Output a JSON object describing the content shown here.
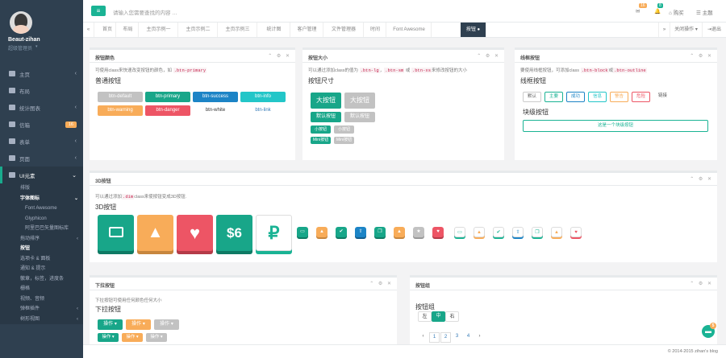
{
  "profile": {
    "name": "Beaut-zihan",
    "role": "超级管理员"
  },
  "sidebar": {
    "items": [
      {
        "label": "主页"
      },
      {
        "label": "布局"
      },
      {
        "label": "统计图表"
      },
      {
        "label": "信箱",
        "badge": "16"
      },
      {
        "label": "表单"
      },
      {
        "label": "页面"
      },
      {
        "label": "UI元素"
      }
    ],
    "sub": [
      "排版",
      "字体图标",
      "Font Awesome",
      "Glyphicon",
      "阿里巴巴矢量图标库",
      "拖动排序",
      "按钮",
      "选项卡 & 面板",
      "通知 & 提示",
      "徽章，标签，进度条",
      "栅格",
      "视频、音频",
      "弹框插件",
      "树形视图"
    ]
  },
  "top": {
    "search": "请输入您需要查找的内容 …",
    "msg_badge": "16",
    "bell_badge": "8",
    "nav1": "购买",
    "nav2": "主题"
  },
  "tabs": {
    "items": [
      "首页",
      "布局",
      "主页示例一",
      "主页示例二",
      "主页示例三",
      "统计图",
      "客户管理",
      "文件管理器",
      "时间",
      "Font Awesome",
      "按钮"
    ],
    "op": "关闭操作",
    "out": "退出"
  },
  "p1": {
    "title": "按钮颜色",
    "desc": "可使用class来快速改变按钮的颜色，如",
    "code": ".btn-primary",
    "h": "普通按钮",
    "btns": [
      "btn-default",
      "btn-primary",
      "btn-success",
      "btn-info",
      "btn-warning",
      "btn-danger",
      "btn-white",
      "btn-link"
    ]
  },
  "p2": {
    "title": "按钮大小",
    "desc1": "可以通过添加class的值为",
    "c1": ".btn-lg",
    ",": "，",
    "c2": ".btn-sm",
    "or": "或",
    "c3": ".btn-xs",
    "desc2": "来修改按钮的大小",
    "h": "按钮尺寸",
    "lg": "大按钮",
    "def": "默认按钮",
    "sm": "小按钮",
    "xs": "Mini按钮"
  },
  "p3": {
    "title": "线框按钮",
    "desc": "要使用线框按钮，可添加class",
    "c1": ".btn-block",
    "and": "或",
    "c2": ".btn-outline",
    "h": "线框按钮",
    "btns": [
      "默认",
      "主要",
      "成功",
      "信息",
      "警告",
      "危险"
    ],
    "link": "链接",
    "h2": "块级按钮",
    "block": "这是一个块级按钮"
  },
  "p4": {
    "title": "3D按钮",
    "desc": "可以通过添加",
    "code": ".dim",
    "desc2": "class来使按钮变成3D按钮.",
    "h": "3D按钮",
    "dollar": "$6"
  },
  "p5": {
    "title": "下拉按钮",
    "desc": "下拉按钮可使用任何颜色任何大小",
    "h": "下拉按钮",
    "op": "操作 ▾",
    "op2": "操作 ▾"
  },
  "p6": {
    "title": "按钮组",
    "h": "按钮组",
    "g": [
      "左",
      "中",
      "右"
    ],
    "pages": [
      "‹",
      "1",
      "2",
      "3",
      "4",
      "›"
    ]
  },
  "footer": "© 2014-2015 zihan's blog",
  "chat_badge": "5",
  "colors": {
    "primary": "#1ab394",
    "sidebar": "#2f4050",
    "warning": "#f8ac59",
    "danger": "#ed5565",
    "success": "#1c84c6"
  }
}
